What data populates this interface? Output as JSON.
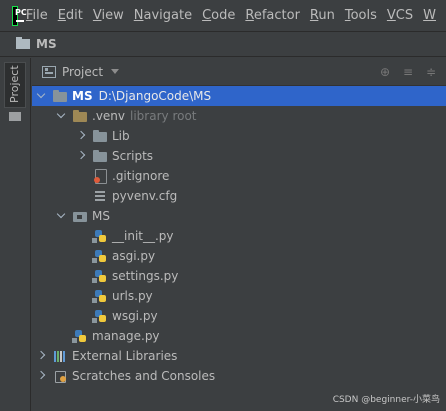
{
  "app": {
    "logo_text": "PC"
  },
  "menu": [
    {
      "label": "File",
      "mnemonic": "F",
      "rest": "ile"
    },
    {
      "label": "Edit",
      "mnemonic": "E",
      "rest": "dit"
    },
    {
      "label": "View",
      "mnemonic": "V",
      "rest": "iew"
    },
    {
      "label": "Navigate",
      "mnemonic": "N",
      "rest": "avigate"
    },
    {
      "label": "Code",
      "mnemonic": "C",
      "rest": "ode"
    },
    {
      "label": "Refactor",
      "mnemonic": "R",
      "rest": "efactor"
    },
    {
      "label": "Run",
      "mnemonic": "R",
      "rest": "un"
    },
    {
      "label": "Tools",
      "mnemonic": "T",
      "rest": "ools"
    },
    {
      "label": "VCS",
      "mnemonic": "V",
      "rest": "CS"
    },
    {
      "label": "W",
      "mnemonic": "W",
      "rest": ""
    }
  ],
  "navbar": {
    "title": "MS"
  },
  "sidebar": {
    "tab_label": "Project"
  },
  "toolwindow": {
    "title": "Project",
    "actions": [
      "locate-icon",
      "collapse-all-icon",
      "expand-all-icon"
    ]
  },
  "tree": [
    {
      "label": "MS",
      "path": "D:\\DjangoCode\\MS",
      "icon": "folder-icon",
      "arrow": "down",
      "indent": 0,
      "selected": true,
      "bold": true
    },
    {
      "label": ".venv",
      "hint": "library root",
      "icon": "venv-folder-icon",
      "arrow": "down",
      "indent": 1
    },
    {
      "label": "Lib",
      "icon": "folder-icon",
      "arrow": "right",
      "indent": 2
    },
    {
      "label": "Scripts",
      "icon": "folder-icon",
      "arrow": "right",
      "indent": 2
    },
    {
      "label": ".gitignore",
      "icon": "gitignore-file-icon",
      "arrow": "none",
      "indent": 2
    },
    {
      "label": "pyvenv.cfg",
      "icon": "config-file-icon",
      "arrow": "none",
      "indent": 2
    },
    {
      "label": "MS",
      "icon": "package-folder-icon",
      "arrow": "down",
      "indent": 1
    },
    {
      "label": "__init__.py",
      "icon": "python-file-icon",
      "arrow": "none",
      "indent": 2
    },
    {
      "label": "asgi.py",
      "icon": "python-file-icon",
      "arrow": "none",
      "indent": 2
    },
    {
      "label": "settings.py",
      "icon": "python-file-icon",
      "arrow": "none",
      "indent": 2
    },
    {
      "label": "urls.py",
      "icon": "python-file-icon",
      "arrow": "none",
      "indent": 2
    },
    {
      "label": "wsgi.py",
      "icon": "python-file-icon",
      "arrow": "none",
      "indent": 2
    },
    {
      "label": "manage.py",
      "icon": "python-file-icon",
      "arrow": "none",
      "indent": 1
    },
    {
      "label": "External Libraries",
      "icon": "libraries-icon",
      "arrow": "right",
      "indent": 0
    },
    {
      "label": "Scratches and Consoles",
      "icon": "scratches-icon",
      "arrow": "right",
      "indent": 0
    }
  ],
  "watermark": "CSDN @beginner-小菜鸟"
}
